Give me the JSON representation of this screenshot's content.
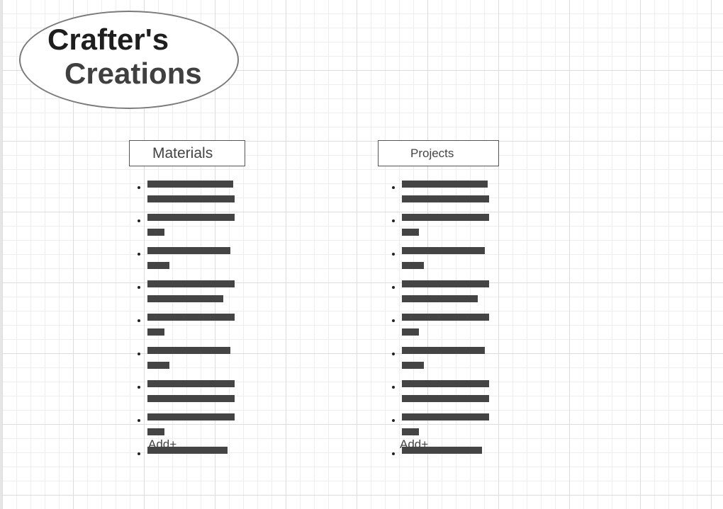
{
  "logo": {
    "line1": "Crafter's",
    "line2": "Creations"
  },
  "materials": {
    "header": "Materials",
    "add_label": "Add+",
    "items": [
      {
        "lines": [
          121,
          123
        ]
      },
      {
        "lines": [
          123,
          24
        ]
      },
      {
        "lines": [
          117,
          31
        ]
      },
      {
        "lines": [
          123,
          107
        ]
      },
      {
        "lines": [
          123,
          24
        ]
      },
      {
        "lines": [
          117,
          31
        ]
      },
      {
        "lines": [
          123,
          123
        ]
      },
      {
        "lines": [
          123,
          24
        ]
      },
      {
        "lines": [
          113
        ]
      }
    ]
  },
  "projects": {
    "header": "Projects",
    "add_label": "Add+",
    "items": [
      {
        "lines": [
          121,
          123
        ]
      },
      {
        "lines": [
          123,
          24
        ]
      },
      {
        "lines": [
          117,
          31
        ]
      },
      {
        "lines": [
          123,
          107
        ]
      },
      {
        "lines": [
          123,
          24
        ]
      },
      {
        "lines": [
          117,
          31
        ]
      },
      {
        "lines": [
          123,
          123
        ]
      },
      {
        "lines": [
          123,
          24
        ]
      },
      {
        "lines": [
          113
        ]
      }
    ]
  }
}
